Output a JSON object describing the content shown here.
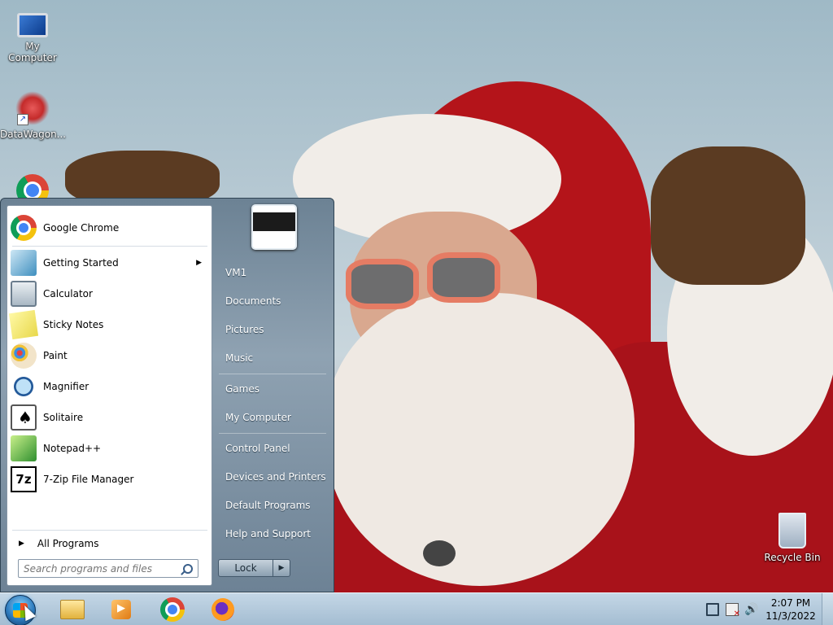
{
  "desktop": {
    "icons": [
      {
        "label": "My Computer"
      },
      {
        "label": "DataWagon..."
      },
      {
        "label": "Recycle Bin"
      }
    ]
  },
  "start_menu": {
    "pinned": [
      {
        "label": "Google Chrome",
        "icon": "chrome-icon"
      }
    ],
    "recent": [
      {
        "label": "Getting Started",
        "icon": "getting-started-icon",
        "has_submenu": true
      },
      {
        "label": "Calculator",
        "icon": "calculator-icon"
      },
      {
        "label": "Sticky Notes",
        "icon": "sticky-notes-icon"
      },
      {
        "label": "Paint",
        "icon": "paint-icon"
      },
      {
        "label": "Magnifier",
        "icon": "magnifier-icon"
      },
      {
        "label": "Solitaire",
        "icon": "solitaire-icon"
      },
      {
        "label": "Notepad++",
        "icon": "notepadpp-icon"
      },
      {
        "label": "7-Zip File Manager",
        "icon": "7zip-icon",
        "icon_text": "7z"
      }
    ],
    "all_programs": "All Programs",
    "search_placeholder": "Search programs and files",
    "right_links": [
      {
        "label": "VM1"
      },
      {
        "label": "Documents"
      },
      {
        "label": "Pictures"
      },
      {
        "label": "Music"
      },
      {
        "label": "Games"
      },
      {
        "label": "My Computer"
      },
      {
        "label": "Control Panel"
      },
      {
        "label": "Devices and Printers"
      },
      {
        "label": "Default Programs"
      },
      {
        "label": "Help and Support"
      }
    ],
    "lock_label": "Lock"
  },
  "taskbar": {
    "pinned": [
      "windows-explorer-icon",
      "media-player-icon",
      "chrome-icon",
      "firefox-icon"
    ],
    "clock": {
      "time": "2:07 PM",
      "date": "11/3/2022"
    }
  },
  "colors": {
    "taskbar": "#b4cadc",
    "start_menu_right": "#7f94a5",
    "santa_red": "#a8121a"
  }
}
